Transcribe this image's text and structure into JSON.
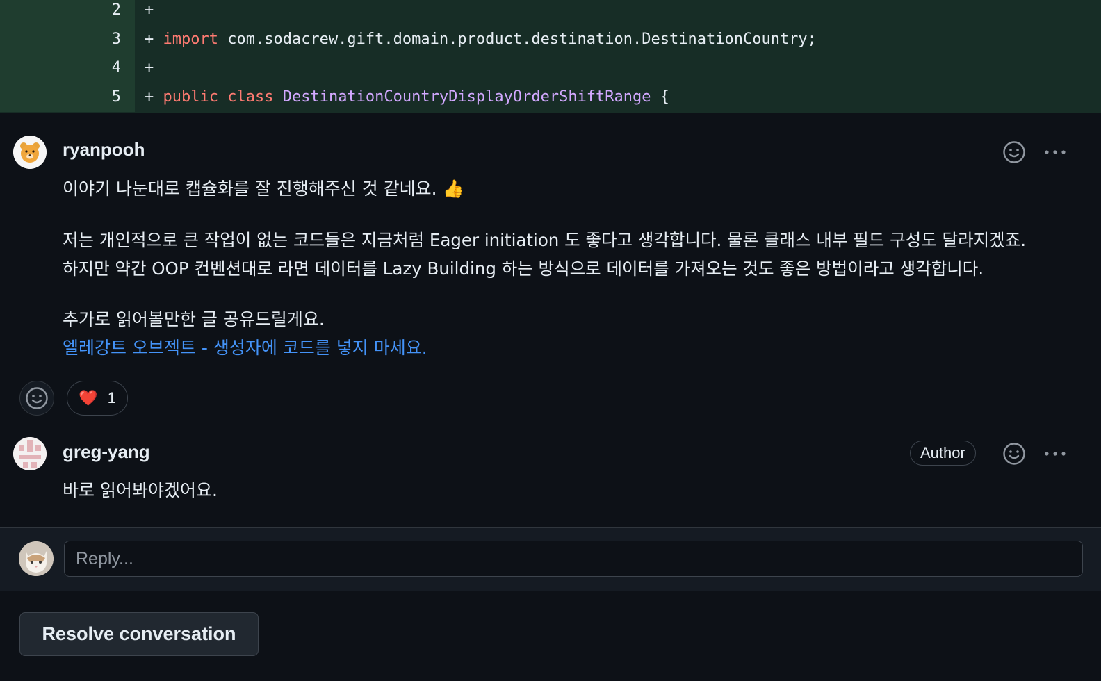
{
  "diff": {
    "lines": [
      {
        "num": "2",
        "sign": "+",
        "parts": []
      },
      {
        "num": "3",
        "sign": "+",
        "parts": [
          {
            "t": "import",
            "c": "kw"
          },
          {
            "t": " com.sodacrew.gift.domain.product.destination.DestinationCountry;",
            "c": ""
          }
        ]
      },
      {
        "num": "4",
        "sign": "+",
        "parts": []
      },
      {
        "num": "5",
        "sign": "+",
        "parts": [
          {
            "t": "public",
            "c": "kw"
          },
          {
            "t": " ",
            "c": ""
          },
          {
            "t": "class",
            "c": "kw"
          },
          {
            "t": " ",
            "c": ""
          },
          {
            "t": "DestinationCountryDisplayOrderShiftRange",
            "c": "cls"
          },
          {
            "t": " {",
            "c": ""
          }
        ]
      }
    ]
  },
  "comments": [
    {
      "author": "ryanpooh",
      "line1": "이야기 나눈대로 캡슐화를 잘 진행해주신 것 같네요. 👍",
      "line2": "저는 개인적으로 큰 작업이 없는 코드들은 지금처럼 Eager initiation 도 좋다고 생각합니다. 물론 클래스 내부 필드 구성도 달라지겠죠.",
      "line3": "하지만 약간 OOP 컨벤션대로 라면 데이터를 Lazy Building 하는 방식으로 데이터를 가져오는 것도 좋은 방법이라고 생각합니다.",
      "line4": "추가로 읽어볼만한 글 공유드릴게요.",
      "link": "엘레강트 오브젝트 - 생성자에 코드를 넣지 마세요.",
      "reaction": {
        "emoji": "❤️",
        "count": "1"
      }
    },
    {
      "author": "greg-yang",
      "badge": "Author",
      "line1": "바로 읽어봐야겠어요."
    }
  ],
  "reply": {
    "placeholder": "Reply..."
  },
  "resolve_label": "Resolve conversation",
  "colors": {
    "bg": "#0d1117",
    "diff_bg": "#172d26",
    "keyword": "#ff7b72",
    "class_name": "#d2a8ff",
    "link": "#4493f8"
  }
}
